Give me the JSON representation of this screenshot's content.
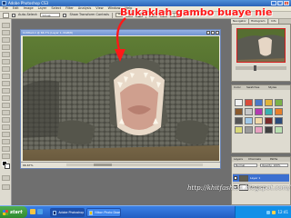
{
  "app": {
    "title": "Adobe Photoshop CS3"
  },
  "menu": [
    "File",
    "Edit",
    "Image",
    "Layer",
    "Select",
    "Filter",
    "Analysis",
    "View",
    "Window",
    "Help"
  ],
  "options": {
    "auto_select_label": "Auto-Select:",
    "auto_select_value": "Group",
    "transform_label": "Show Transform Controls"
  },
  "document": {
    "title": "Untitled-1 @ 66.7% (Layer 1, RGB/8)",
    "zoom": "66.67%",
    "status": "Doc: 1.41M/2.01M"
  },
  "panels": {
    "tabs": [
      "Navigator",
      "Histogram",
      "Info"
    ],
    "swatch_tabs": [
      "Color",
      "Swatches",
      "Styles"
    ],
    "layers": {
      "tabs": [
        "Layers",
        "Channels",
        "Paths"
      ],
      "blend_mode": "Normal",
      "opacity": "Opacity: 100%",
      "items": [
        "Layer 1",
        "Background"
      ]
    }
  },
  "annotation": "Bukaklah gambo buaye nie",
  "watermark": "http://khitfashion.blogspot.com/",
  "taskbar": {
    "start": "start",
    "buttons": [
      "Adobe Photoshop C...",
      "Nikon Photo Downlo..."
    ],
    "clock": "12:41"
  },
  "colors": {
    "annotation": "#ff1818",
    "titlebar": "#2a63b8",
    "taskbar": "#225ec2"
  }
}
